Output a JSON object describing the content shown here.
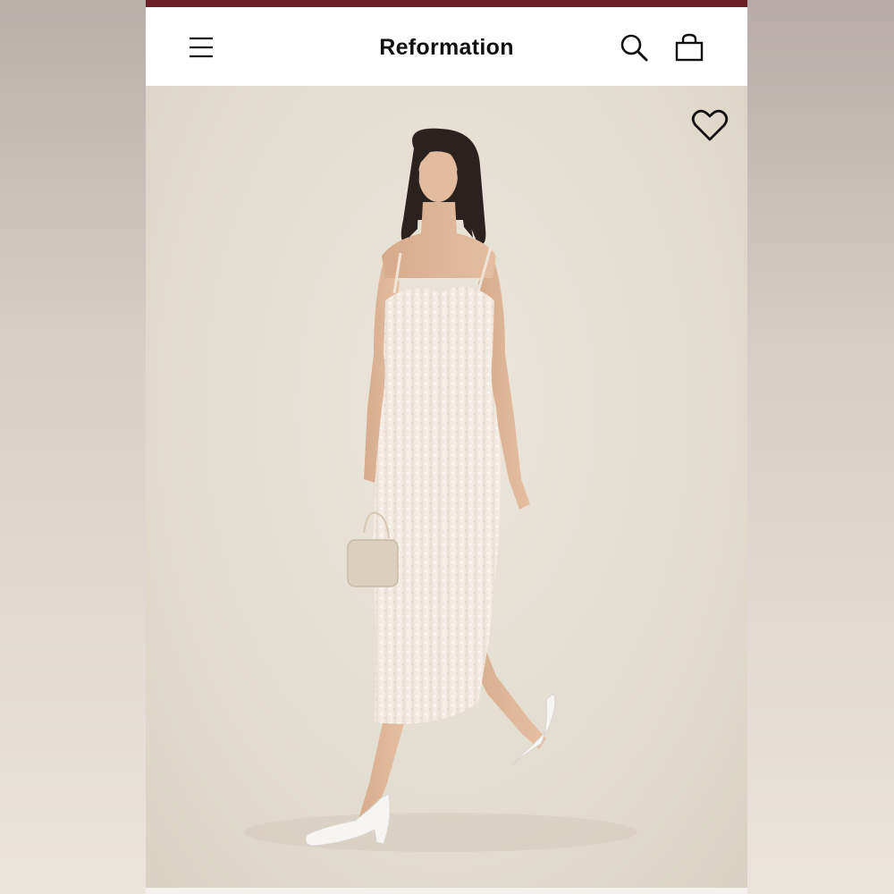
{
  "header": {
    "brand": "Reformation",
    "accent_color": "#6a2025",
    "menu_icon": "hamburger-menu-icon",
    "search_icon": "search-icon",
    "bag_icon": "shopping-bag-icon"
  },
  "product_image": {
    "wishlist_icon": "heart-outline-icon",
    "background_color": "#e6e0d3"
  }
}
